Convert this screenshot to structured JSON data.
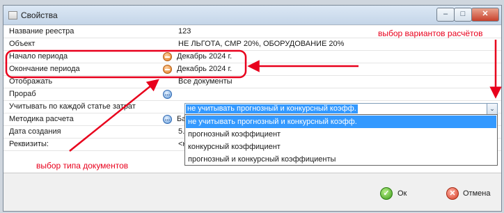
{
  "window": {
    "title": "Свойства",
    "min_glyph": "–",
    "max_glyph": "□",
    "close_glyph": "✕"
  },
  "properties": [
    {
      "label": "Название реестра",
      "value": "123",
      "icon": ""
    },
    {
      "label": "Объект",
      "value": "НЕ ЛЬГОТА, СМР 20%, ОБОРУДОВАНИЕ 20%",
      "icon": ""
    },
    {
      "label": "Начало периода",
      "value": "Декабрь 2024 г.",
      "icon": "minus-circle-icon"
    },
    {
      "label": "Окончание периода",
      "value": "Декабрь 2024 г.",
      "icon": "minus-circle-icon"
    },
    {
      "label": "Отображать",
      "value": "Все документы",
      "icon": ""
    },
    {
      "label": "Прораб",
      "value": "",
      "icon": "ellipsis-circle-icon"
    },
    {
      "label": "Учитывать по каждой статье затрат",
      "value": "",
      "icon": ""
    },
    {
      "label": "Методика расчета",
      "value": "Ба",
      "icon": "ellipsis-circle-icon"
    },
    {
      "label": "Дата создания",
      "value": "5.",
      "icon": ""
    },
    {
      "label": "Реквизиты:",
      "value": "<н",
      "icon": ""
    }
  ],
  "cost_combo": {
    "selected": "не учитывать прогнозный и конкурсный коэфф.",
    "arrow_glyph": "⌄",
    "options": [
      "не учитывать прогнозный и конкурсный коэфф.",
      "прогнозный коэффициент",
      "конкурсный коэффициент",
      "прогнозный и конкурсный коэффициенты"
    ],
    "selected_index": 0
  },
  "buttons": {
    "ok_label": "Ок",
    "ok_glyph": "✓",
    "cancel_label": "Отмена",
    "cancel_glyph": "✕"
  },
  "annotations": {
    "calc_options": "выбор вариантов расчётов",
    "doc_type": "выбор типа документов"
  },
  "colors": {
    "annotation": "#e8001c",
    "selection": "#3399ff"
  }
}
